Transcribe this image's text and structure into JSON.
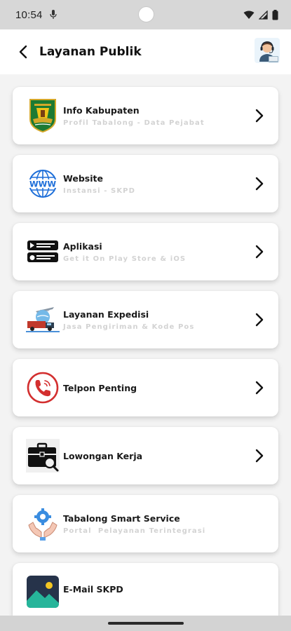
{
  "status_bar": {
    "time": "10:54"
  },
  "header": {
    "title": "Layanan Publik"
  },
  "items": [
    {
      "title": "Info Kabupaten",
      "subtitle": "Profil Tabalong - Data Pejabat",
      "icon": "regency-emblem-icon",
      "has_chevron": true
    },
    {
      "title": "Website",
      "subtitle": "Instansi - SKPD",
      "icon": "www-globe-icon",
      "has_chevron": true
    },
    {
      "title": "Aplikasi",
      "subtitle": "Get it On Play Store & iOS",
      "icon": "app-store-badges-icon",
      "has_chevron": true
    },
    {
      "title": "Layanan Expedisi",
      "subtitle": "Jasa Pengiriman & Kode Pos",
      "icon": "shipping-transport-icon",
      "has_chevron": true
    },
    {
      "title": "Telpon Penting",
      "subtitle": "",
      "icon": "phone-call-icon",
      "has_chevron": true
    },
    {
      "title": "Lowongan Kerja",
      "subtitle": "",
      "icon": "briefcase-search-icon",
      "has_chevron": true
    },
    {
      "title": "Tabalong Smart Service",
      "subtitle": "Portal  Pelayanan Terintegrasi",
      "icon": "smart-service-hands-icon",
      "has_chevron": false
    },
    {
      "title": "E-Mail SKPD",
      "subtitle": "",
      "icon": "image-placeholder-icon",
      "has_chevron": false
    }
  ],
  "colors": {
    "status_bar_bg": "#d7d7d7",
    "app_bar_bg": "#ffffff",
    "list_bg": "#f3f3f3",
    "card_bg": "#ffffff",
    "title_text": "#1a1a1a",
    "subtitle_text": "#d3d3d3",
    "phone_red": "#d32f2f",
    "www_blue": "#1e6fd9"
  }
}
